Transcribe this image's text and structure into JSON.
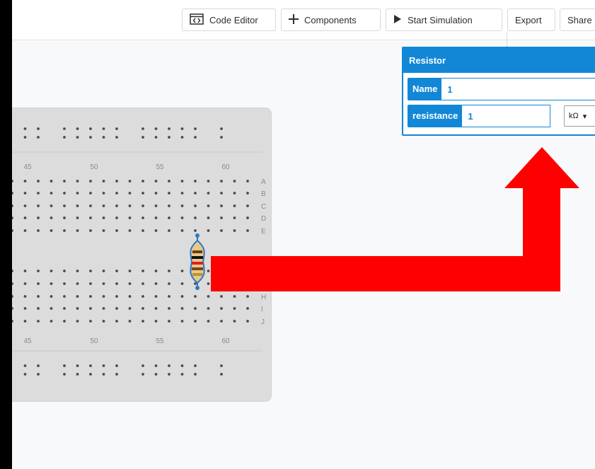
{
  "toolbar": {
    "code_editor_label": "Code Editor",
    "components_label": "Components",
    "start_simulation_label": "Start Simulation",
    "export_label": "Export",
    "share_label": "Share"
  },
  "breadboard": {
    "column_numbers": [
      "45",
      "50",
      "55",
      "60"
    ],
    "row_letters_top": [
      "A",
      "B",
      "C",
      "D",
      "E"
    ],
    "row_letters_bottom": [
      "H",
      "I",
      "J"
    ]
  },
  "properties_panel": {
    "title": "Resistor",
    "name_label": "Name",
    "name_value": "1",
    "resistance_label": "resistance",
    "resistance_value": "1",
    "unit_value": "kΩ",
    "dropdown_glyph": "▾"
  },
  "annotation": {
    "arrow_color": "#ff0000",
    "panel_color": "#1287d6"
  }
}
